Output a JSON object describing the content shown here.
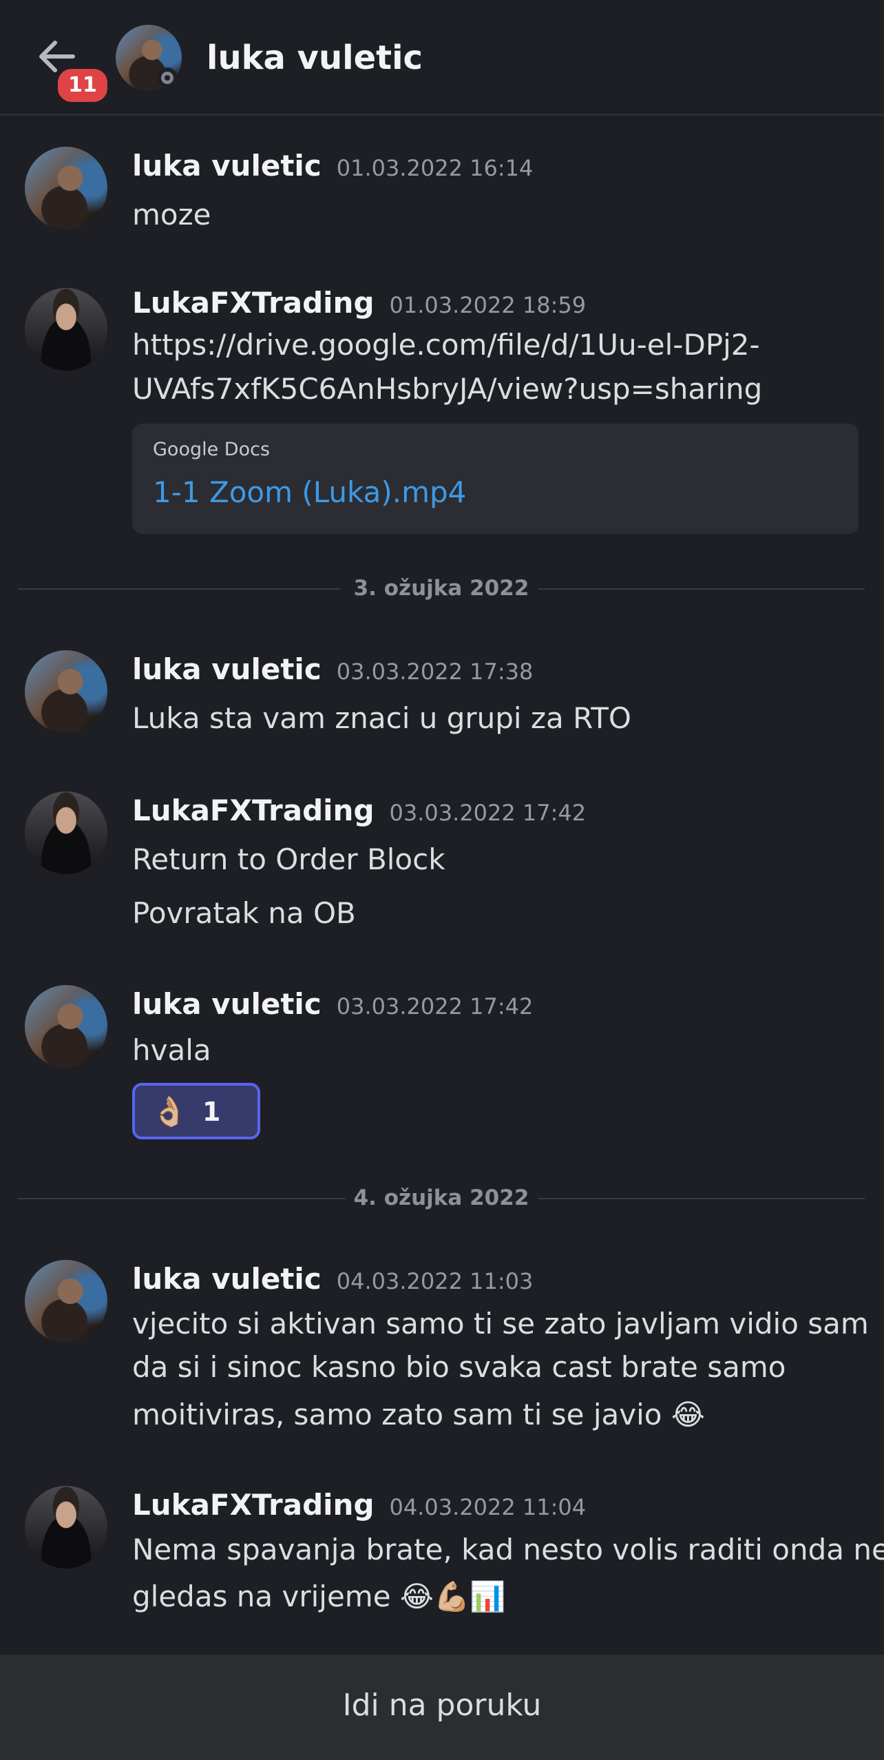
{
  "header": {
    "title": "luka vuletic",
    "badge_count": "11",
    "status": "offline"
  },
  "messages": [
    {
      "author": "luka vuletic",
      "timestamp": "01.03.2022 16:14",
      "lines": [
        "moze"
      ]
    },
    {
      "author": "LukaFXTrading",
      "timestamp": "01.03.2022 18:59",
      "lines": [
        "https://drive.google.com/file/d/1Uu-el-DPj2-",
        "UVAfs7xfK5C6AnHsbryJA/view?usp=sharing"
      ],
      "embed": {
        "provider": "Google Docs",
        "title": "1-1 Zoom (Luka).mp4"
      }
    },
    {
      "author": "luka vuletic",
      "timestamp": "03.03.2022 17:38",
      "lines": [
        "Luka sta vam znaci u grupi za RTO"
      ]
    },
    {
      "author": "LukaFXTrading",
      "timestamp": "03.03.2022 17:42",
      "lines": [
        "Return to Order Block",
        "Povratak na OB"
      ]
    },
    {
      "author": "luka vuletic",
      "timestamp": "03.03.2022 17:42",
      "lines": [
        "hvala"
      ],
      "reaction": {
        "emoji": "👌🏼",
        "count": "1"
      }
    },
    {
      "author": "luka vuletic",
      "timestamp": "04.03.2022 11:03",
      "lines": [
        "vjecito si aktivan samo ti se zato javljam vidio sam",
        "da si i sinoc kasno bio svaka cast brate samo",
        "moitiviras, samo zato sam ti se javio 😂"
      ]
    },
    {
      "author": "LukaFXTrading",
      "timestamp": "04.03.2022 11:04",
      "lines": [
        "Nema spavanja brate, kad nesto volis raditi onda ne",
        "gledas na vrijeme 😂💪🏼📊"
      ]
    }
  ],
  "dividers": [
    "3. ožujka 2022",
    "4. ožujka 2022"
  ],
  "footer": {
    "jump_label": "Idi na poruku"
  },
  "colors": {
    "background": "#1e1f24",
    "link": "#3e9ae6",
    "badge": "#e04346",
    "reaction_border": "#5865f2"
  }
}
